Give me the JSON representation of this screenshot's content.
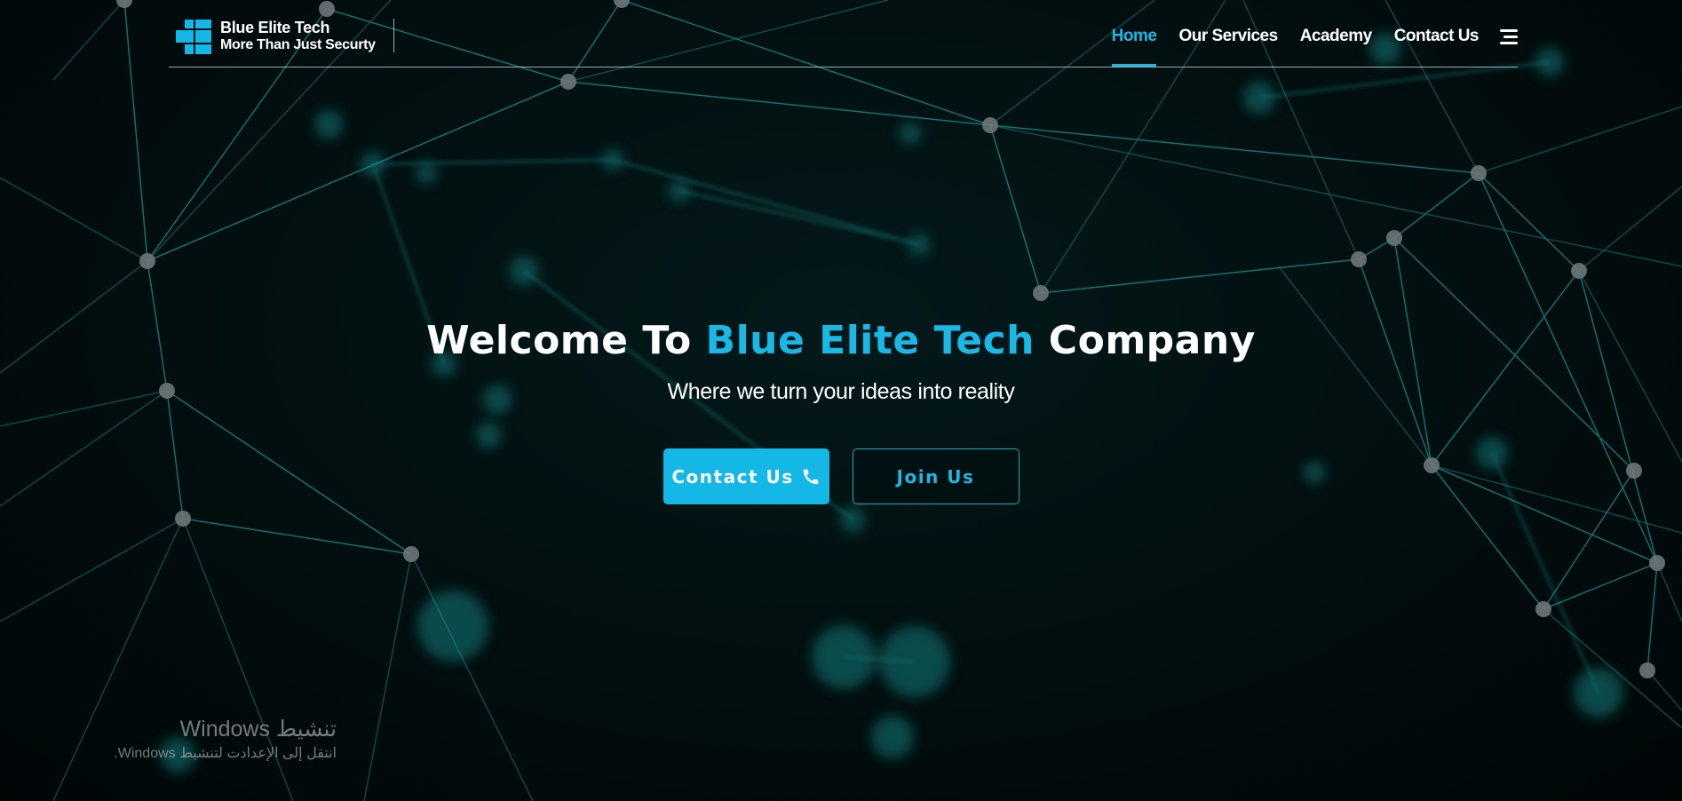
{
  "brand": {
    "name": "Blue Elite Tech",
    "tagline": "More Than Just Securty"
  },
  "nav": {
    "items": [
      {
        "label": "Home",
        "active": true
      },
      {
        "label": "Our Services",
        "active": false
      },
      {
        "label": "Academy",
        "active": false
      },
      {
        "label": "Contact Us",
        "active": false
      }
    ],
    "menu_icon": "hamburger-menu-icon"
  },
  "hero": {
    "title_prefix": "Welcome To ",
    "title_highlight": "Blue Elite Tech",
    "title_suffix": " Company",
    "subtitle": "Where we turn your ideas into reality",
    "primary_button": "Contact Us",
    "primary_button_icon": "phone-icon",
    "secondary_button": "Join Us"
  },
  "activation_notice": {
    "title": "تنشيط Windows",
    "subtitle": "انتقل إلى الإعدادت لتنشيط Windows."
  },
  "colors": {
    "accent": "#14b8e6",
    "background": "#020a0b",
    "network_lines": "#1a8f8f",
    "text": "#ffffff"
  }
}
